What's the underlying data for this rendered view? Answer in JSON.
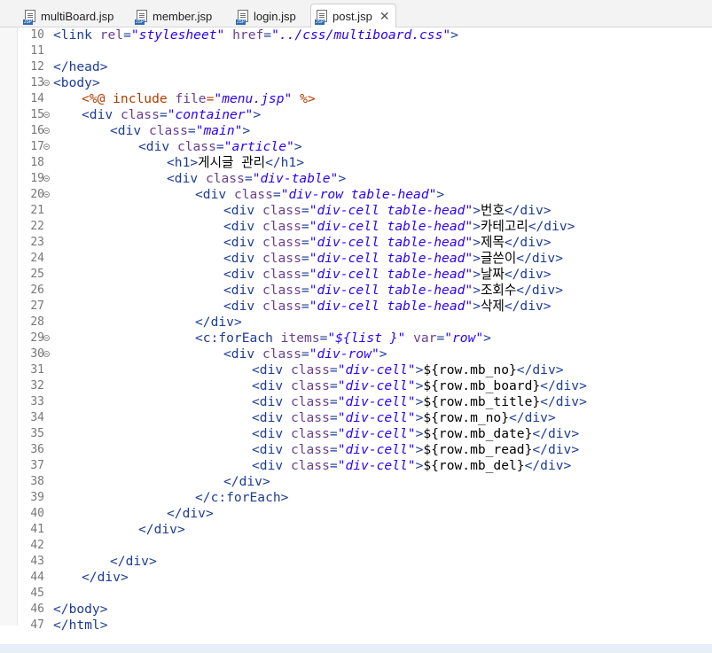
{
  "tabs": [
    {
      "label": "multiBoard.jsp",
      "active": false
    },
    {
      "label": "member.jsp",
      "active": false
    },
    {
      "label": "login.jsp",
      "active": false
    },
    {
      "label": "post.jsp",
      "active": true
    }
  ],
  "editor": {
    "lines": {
      "l10": {
        "num": "10",
        "text": "<link rel=\"stylesheet\" href=\"../css/multiboard.css\">"
      },
      "l11": {
        "num": "11",
        "text": ""
      },
      "l12": {
        "num": "12",
        "text": "</head>"
      },
      "l13": {
        "num": "13",
        "text": "<body>"
      },
      "l14": {
        "num": "14",
        "text": "<%@ include file=\"menu.jsp\" %>"
      },
      "l15": {
        "num": "15",
        "text": "<div class=\"container\">"
      },
      "l16": {
        "num": "16",
        "text": "<div class=\"main\">"
      },
      "l17": {
        "num": "17",
        "text": "<div class=\"article\">"
      },
      "l18": {
        "num": "18",
        "text": "<h1>게시글 관리</h1>"
      },
      "l19": {
        "num": "19",
        "text": "<div class=\"div-table\">"
      },
      "l20": {
        "num": "20",
        "text": "<div class=\"div-row table-head\">"
      },
      "l21": {
        "num": "21",
        "text": "<div class=\"div-cell table-head\">번호</div>"
      },
      "l22": {
        "num": "22",
        "text": "<div class=\"div-cell table-head\">카테고리</div>"
      },
      "l23": {
        "num": "23",
        "text": "<div class=\"div-cell table-head\">제목</div>"
      },
      "l24": {
        "num": "24",
        "text": "<div class=\"div-cell table-head\">글쓴이</div>"
      },
      "l25": {
        "num": "25",
        "text": "<div class=\"div-cell table-head\">날짜</div>"
      },
      "l26": {
        "num": "26",
        "text": "<div class=\"div-cell table-head\">조회수</div>"
      },
      "l27": {
        "num": "27",
        "text": "<div class=\"div-cell table-head\">삭제</div>"
      },
      "l28": {
        "num": "28",
        "text": "</div>"
      },
      "l29": {
        "num": "29",
        "text": "<c:forEach items=\"${list }\" var=\"row\">"
      },
      "l30": {
        "num": "30",
        "text": "<div class=\"div-row\">"
      },
      "l31": {
        "num": "31",
        "text": "<div class=\"div-cell\">${row.mb_no}</div>"
      },
      "l32": {
        "num": "32",
        "text": "<div class=\"div-cell\">${row.mb_board}</div>"
      },
      "l33": {
        "num": "33",
        "text": "<div class=\"div-cell\">${row.mb_title}</div>"
      },
      "l34": {
        "num": "34",
        "text": "<div class=\"div-cell\">${row.m_no}</div>"
      },
      "l35": {
        "num": "35",
        "text": "<div class=\"div-cell\">${row.mb_date}</div>"
      },
      "l36": {
        "num": "36",
        "text": "<div class=\"div-cell\">${row.mb_read}</div>"
      },
      "l37": {
        "num": "37",
        "text": "<div class=\"div-cell\">${row.mb_del}</div>"
      },
      "l38": {
        "num": "38",
        "text": "</div>"
      },
      "l39": {
        "num": "39",
        "text": "</c:forEach>"
      },
      "l40": {
        "num": "40",
        "text": "</div>"
      },
      "l41": {
        "num": "41",
        "text": "</div>"
      },
      "l42": {
        "num": "42",
        "text": ""
      },
      "l43": {
        "num": "43",
        "text": "</div>"
      },
      "l44": {
        "num": "44",
        "text": "</div>"
      },
      "l45": {
        "num": "45",
        "text": ""
      },
      "l46": {
        "num": "46",
        "text": "</body>"
      },
      "l47": {
        "num": "47",
        "text": "</html>"
      }
    }
  },
  "colors": {
    "tag": "#1b3c94",
    "attribute": "#6a3f8f",
    "string": "#2a00ff",
    "jsp_directive": "#b23c00"
  }
}
